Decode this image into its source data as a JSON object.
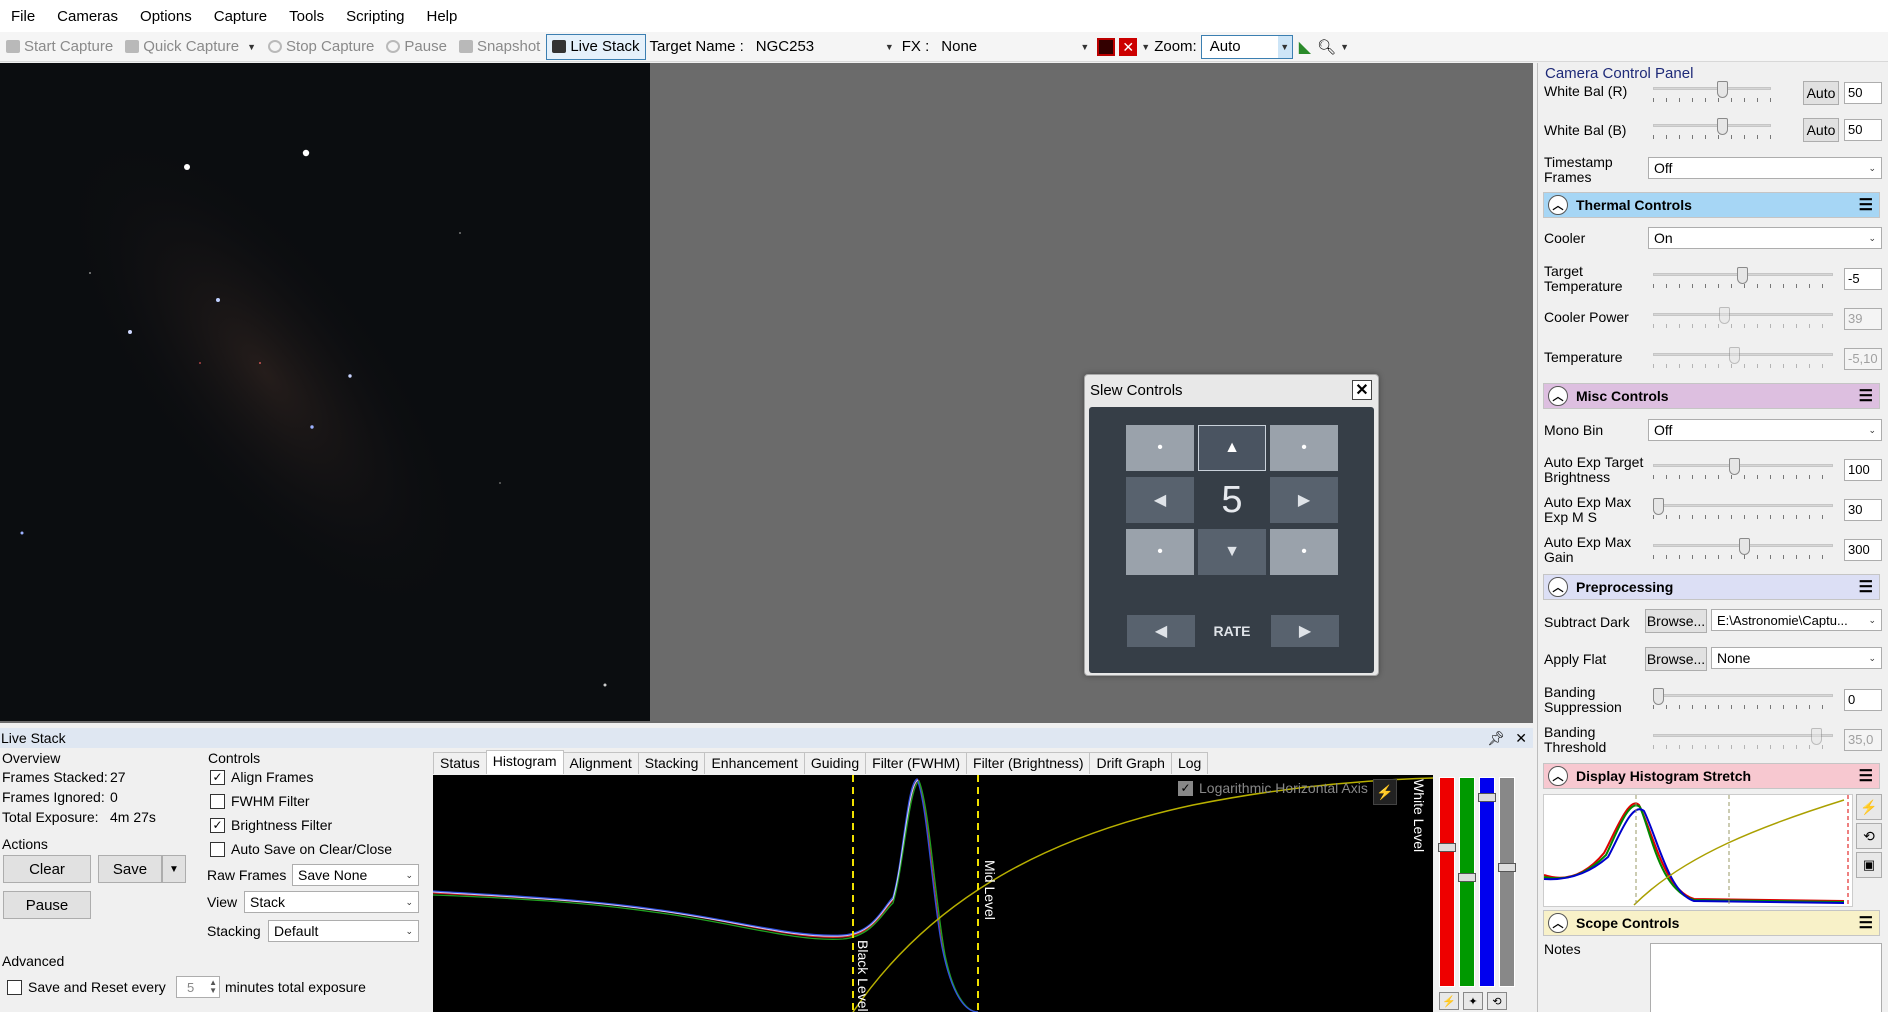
{
  "menu": [
    "File",
    "Cameras",
    "Options",
    "Capture",
    "Tools",
    "Scripting",
    "Help"
  ],
  "toolbar": {
    "start_capture": "Start Capture",
    "quick_capture": "Quick Capture",
    "stop_capture": "Stop Capture",
    "pause": "Pause",
    "snapshot": "Snapshot",
    "live_stack": "Live Stack",
    "target_label": "Target Name :",
    "target_value": "NGC253",
    "fx_label": "FX :",
    "fx_value": "None",
    "zoom_label": "Zoom:",
    "zoom_value": "Auto"
  },
  "slew": {
    "title": "Slew Controls",
    "rate_value": "5",
    "rate_label": "RATE",
    "dot": "•",
    "up": "▲",
    "down": "▼",
    "left": "◀",
    "right": "▶"
  },
  "camera_panel": {
    "title": "Camera Control Panel",
    "white_bal_r": {
      "label": "White Bal (R)",
      "auto": "Auto",
      "value": "50"
    },
    "white_bal_b": {
      "label": "White Bal (B)",
      "auto": "Auto",
      "value": "50"
    },
    "timestamp": {
      "label": "Timestamp Frames",
      "value": "Off"
    },
    "thermal": {
      "title": "Thermal Controls",
      "cooler": {
        "label": "Cooler",
        "value": "On"
      },
      "target_temp": {
        "label": "Target Temperature",
        "value": "-5"
      },
      "cooler_power": {
        "label": "Cooler Power",
        "value": "39"
      },
      "temperature": {
        "label": "Temperature",
        "value": "-5,10"
      }
    },
    "misc": {
      "title": "Misc Controls",
      "mono_bin": {
        "label": "Mono Bin",
        "value": "Off"
      },
      "auto_exp_target": {
        "label": "Auto Exp Target Brightness",
        "value": "100"
      },
      "auto_exp_max_exp": {
        "label": "Auto Exp Max Exp M S",
        "value": "30"
      },
      "auto_exp_max_gain": {
        "label": "Auto Exp Max Gain",
        "value": "300"
      }
    },
    "preprocessing": {
      "title": "Preprocessing",
      "subtract_dark": {
        "label": "Subtract Dark",
        "browse": "Browse...",
        "value": "E:\\Astronomie\\Captu..."
      },
      "apply_flat": {
        "label": "Apply Flat",
        "browse": "Browse...",
        "value": "None"
      },
      "banding_supp": {
        "label": "Banding Suppression",
        "value": "0"
      },
      "banding_thresh": {
        "label": "Banding Threshold",
        "value": "35,0"
      }
    },
    "display_stretch": {
      "title": "Display Histogram Stretch"
    },
    "scope": {
      "title": "Scope Controls",
      "notes_label": "Notes"
    },
    "section_colors": {
      "thermal": "#a6d6f5",
      "misc": "#ddbfe0",
      "preprocessing": "#dcdff5",
      "display_stretch": "#f7c8d0",
      "scope": "#f8f1c8"
    }
  },
  "live_stack": {
    "title": "Live Stack",
    "overview_label": "Overview",
    "frames_stacked": {
      "label": "Frames Stacked:",
      "value": "27"
    },
    "frames_ignored": {
      "label": "Frames Ignored:",
      "value": "0"
    },
    "total_exposure": {
      "label": "Total Exposure:",
      "value": "4m 27s"
    },
    "actions_label": "Actions",
    "clear": "Clear",
    "save": "Save",
    "pause": "Pause",
    "advanced_label": "Advanced",
    "save_reset": "Save and Reset every",
    "save_reset_value": "5",
    "save_reset_suffix": "minutes total exposure",
    "controls_label": "Controls",
    "align_frames": "Align Frames",
    "fwhm_filter": "FWHM Filter",
    "brightness_filter": "Brightness Filter",
    "auto_save": "Auto Save on Clear/Close",
    "raw_frames": {
      "label": "Raw Frames",
      "value": "Save None"
    },
    "view": {
      "label": "View",
      "value": "Stack"
    },
    "stacking": {
      "label": "Stacking",
      "value": "Default"
    },
    "tabs": [
      "Status",
      "Histogram",
      "Alignment",
      "Stacking",
      "Enhancement",
      "Guiding",
      "Filter (FWHM)",
      "Filter (Brightness)",
      "Drift Graph",
      "Log"
    ],
    "histogram": {
      "log_axis": "Logarithmic Horizontal Axis",
      "black_level": "Black Level",
      "mid_level": "Mid Level",
      "white_level": "White Level"
    }
  }
}
